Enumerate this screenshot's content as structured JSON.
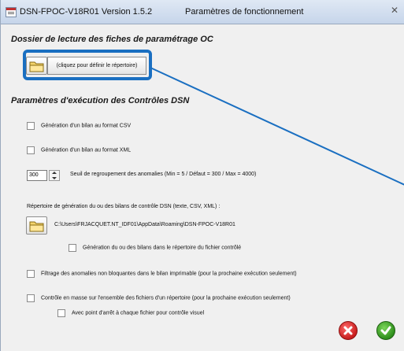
{
  "window": {
    "title": "DSN-FPOC-V18R01 Version 1.5.2",
    "subtitle": "Paramètres de fonctionnement",
    "close_glyph": "✕"
  },
  "section_oc": {
    "title": "Dossier de lecture des fiches de paramétrage OC",
    "define_button_label": "(cliquez pour définir le répertoire)"
  },
  "section_controls": {
    "title": "Paramètres d'exécution des Contrôles DSN",
    "csv_checkbox": {
      "label": "Génération d'un bilan au format CSV",
      "checked": false
    },
    "xml_checkbox": {
      "label": "Génération d'un bilan au format XML",
      "checked": false
    },
    "threshold": {
      "value": "300",
      "label": "Seuil de regroupement des anomalies (Min = 5 / Défaut = 300 / Max = 4000)"
    },
    "output_dir": {
      "label": "Répertoire de génération du ou des bilans de contrôle DSN (texte, CSV, XML) :",
      "path": "C:\\Users\\FRJACQUET.NT_IDF01\\AppData\\Roaming\\DSN-FPOC-V18R01"
    },
    "same_dir_checkbox": {
      "label": "Génération du ou des bilans dans le répertoire du fichier contrôlé",
      "checked": false
    },
    "filter_checkbox": {
      "label": "Filtrage des anomalies non bloquantes dans le bilan imprimable (pour la prochaine exécution seulement)",
      "checked": false
    },
    "mass_checkbox": {
      "label": "Contrôle en masse sur l'ensemble des fichiers d'un répertoire (pour la prochaine exécution seulement)",
      "checked": false
    },
    "stop_checkbox": {
      "label": "Avec point d'arrêt à chaque fichier pour contrôle visuel",
      "checked": false
    }
  },
  "icons": {
    "folder": "folder-icon",
    "cancel": "cancel-icon",
    "validate": "check-icon"
  },
  "colors": {
    "highlight": "#1a6fc1",
    "cancel": "#c81e1e",
    "validate": "#2f8f1c"
  }
}
